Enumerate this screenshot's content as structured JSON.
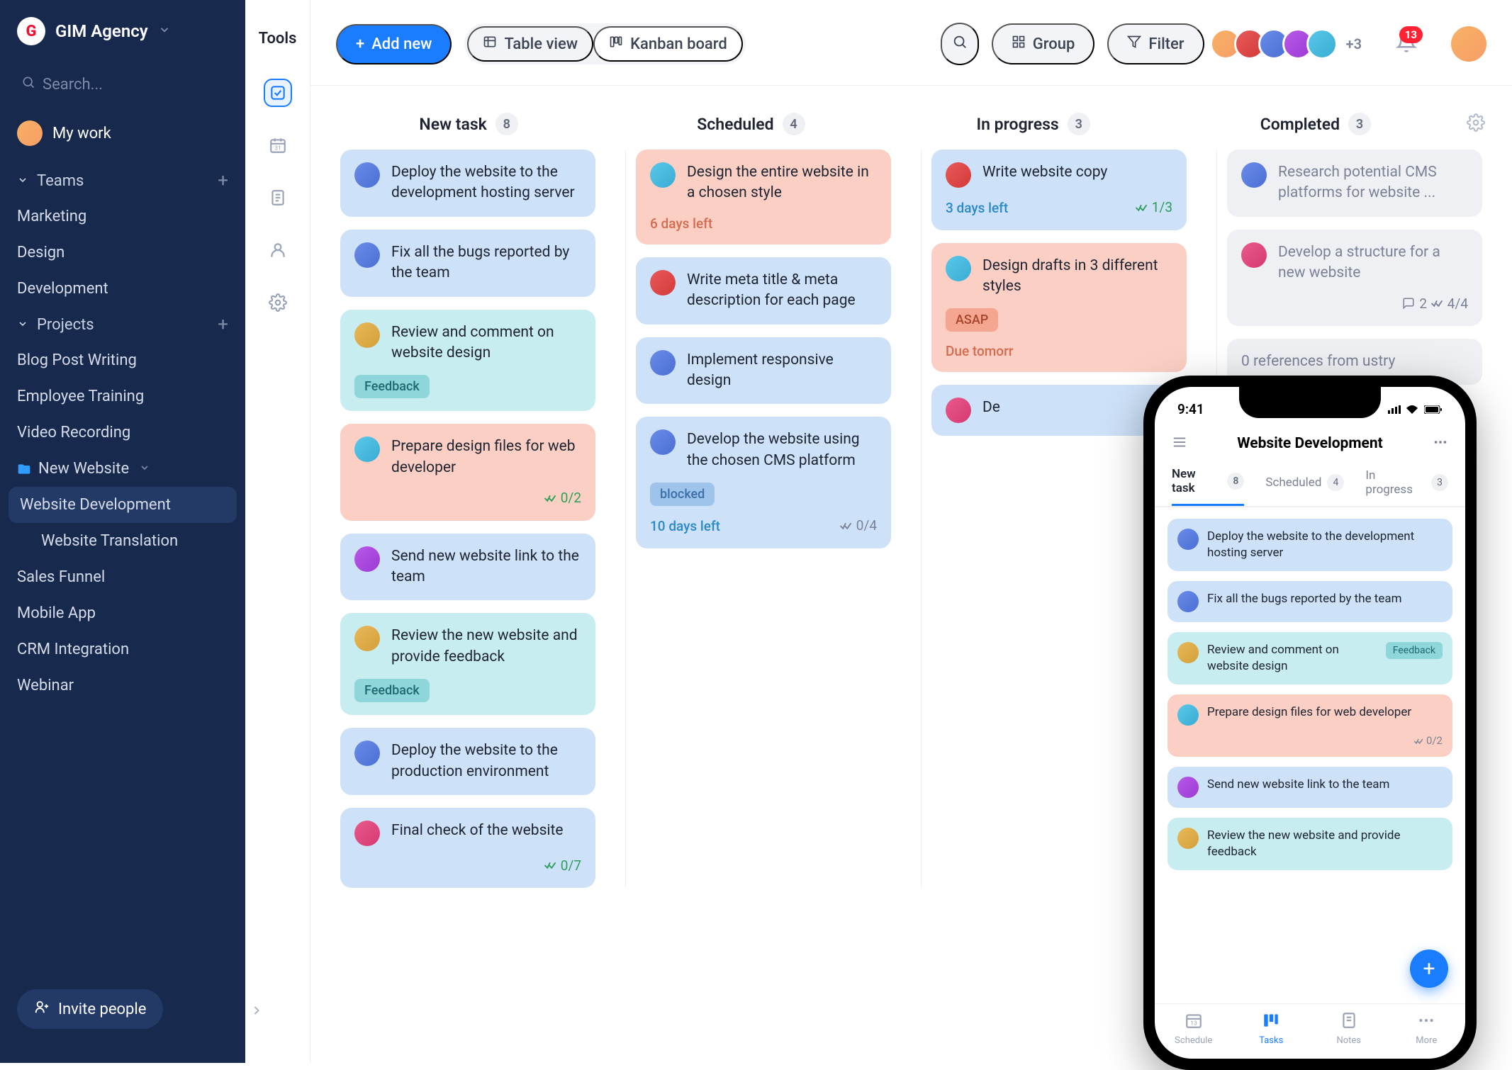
{
  "brand": {
    "name": "GIM Agency",
    "logo_letter": "G"
  },
  "search": {
    "placeholder": "Search..."
  },
  "my_work": {
    "label": "My work"
  },
  "sidebar": {
    "teams_label": "Teams",
    "teams": [
      "Marketing",
      "Design",
      "Development"
    ],
    "projects_label": "Projects",
    "projects": [
      {
        "label": "Blog Post Writing"
      },
      {
        "label": "Employee Training"
      },
      {
        "label": "Video Recording"
      },
      {
        "label": "New Website",
        "expandable": true,
        "children": [
          {
            "label": "Website Development",
            "active": true
          },
          {
            "label": "Website Translation"
          }
        ]
      },
      {
        "label": "Sales Funnel"
      },
      {
        "label": "Mobile App"
      },
      {
        "label": "CRM Integration"
      },
      {
        "label": "Webinar"
      }
    ],
    "invite": "Invite people"
  },
  "rail": {
    "label": "Tools"
  },
  "topbar": {
    "add_new": "Add new",
    "table_view": "Table view",
    "kanban": "Kanban board",
    "group": "Group",
    "filter": "Filter",
    "extra_avatars": "+3",
    "notifications": "13"
  },
  "board": {
    "columns": [
      {
        "title": "New task",
        "count": "8"
      },
      {
        "title": "Scheduled",
        "count": "4"
      },
      {
        "title": "In progress",
        "count": "3"
      },
      {
        "title": "Completed",
        "count": "3"
      }
    ],
    "cards": {
      "new_task": [
        {
          "text": "Deploy the website to the development hosting server",
          "color": "blue",
          "av": "av3"
        },
        {
          "text": "Fix all the bugs reported by the team",
          "color": "blue",
          "av": "av3"
        },
        {
          "text": "Review and comment on website design",
          "color": "mint",
          "av": "av4",
          "tag": "Feedback",
          "tagClass": "feedback"
        },
        {
          "text": "Prepare design files for web developer",
          "color": "peach",
          "av": "av6",
          "progress": "0/2"
        },
        {
          "text": "Send new website link to the team",
          "color": "blue",
          "av": "av5"
        },
        {
          "text": "Review the new website and provide feedback",
          "color": "mint",
          "av": "av4",
          "tag": "Feedback",
          "tagClass": "feedback"
        },
        {
          "text": "Deploy the website to the production environment",
          "color": "blue",
          "av": "av3"
        },
        {
          "text": "Final check of the website",
          "color": "blue",
          "av": "av2",
          "progress": "0/7"
        }
      ],
      "scheduled": [
        {
          "text": "Design the entire website in a chosen style",
          "color": "peach",
          "av": "av6",
          "due": "6 days left"
        },
        {
          "text": "Write meta title & meta description for each page",
          "color": "blue",
          "av": "av7"
        },
        {
          "text": "Implement responsive design",
          "color": "blue",
          "av": "av3"
        },
        {
          "text": "Develop the website using the chosen CMS platform",
          "color": "blue",
          "av": "av3",
          "tag": "blocked",
          "tagClass": "blocked",
          "due": "10 days left",
          "dueClass": "blue",
          "progress": "0/4",
          "progressClass": "grey"
        }
      ],
      "in_progress": [
        {
          "text": "Write website copy",
          "color": "blue",
          "av": "av7",
          "due": "3 days left",
          "dueClass": "blue",
          "progress": "1/3"
        },
        {
          "text": "Design drafts in 3 different styles",
          "color": "peach",
          "av": "av6",
          "tag": "ASAP",
          "tagClass": "asap",
          "due": "Due tomorr"
        },
        {
          "text": "De",
          "color": "blue",
          "av": "av2"
        }
      ],
      "completed": [
        {
          "text": "Research potential CMS platforms for website ...",
          "color": "grey",
          "av": "av3"
        },
        {
          "text": "Develop a structure for a new website",
          "color": "grey",
          "av": "av2",
          "comments": "2",
          "progress": "4/4",
          "progressClass": "grey"
        },
        {
          "text": "0 references from ustry",
          "color": "grey"
        }
      ]
    }
  },
  "phone": {
    "time": "9:41",
    "title": "Website Development",
    "tabs": [
      {
        "label": "New task",
        "count": "8",
        "active": true
      },
      {
        "label": "Scheduled",
        "count": "4"
      },
      {
        "label": "In progress",
        "count": "3"
      }
    ],
    "cards": [
      {
        "text": "Deploy the website to the development hosting server",
        "color": "blue",
        "av": "av3"
      },
      {
        "text": "Fix all the bugs reported by the team",
        "color": "blue",
        "av": "av3"
      },
      {
        "text": "Review and comment on website design",
        "color": "mint",
        "av": "av4",
        "tag": "Feedback"
      },
      {
        "text": "Prepare design files for web developer",
        "color": "peach",
        "av": "av6",
        "progress": "0/2"
      },
      {
        "text": "Send new website link to the team",
        "color": "blue",
        "av": "av5"
      },
      {
        "text": "Review the new website and provide feedback",
        "color": "mint",
        "av": "av4"
      }
    ],
    "nav": [
      {
        "label": "Schedule"
      },
      {
        "label": "Tasks",
        "active": true
      },
      {
        "label": "Notes"
      },
      {
        "label": "More"
      }
    ]
  }
}
